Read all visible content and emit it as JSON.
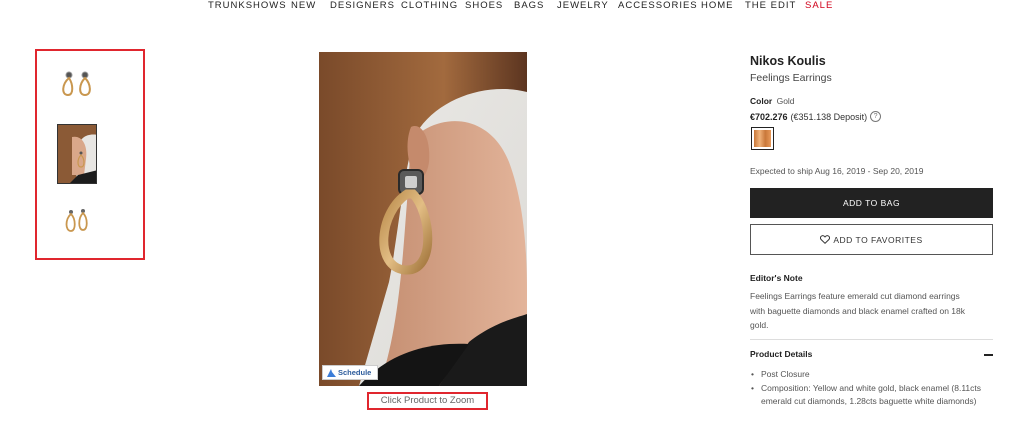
{
  "nav": {
    "items": [
      "TRUNKSHOWS",
      "NEW",
      "DESIGNERS",
      "CLOTHING",
      "SHOES",
      "BAGS",
      "JEWELRY",
      "ACCESSORIES",
      "HOME",
      "THE EDIT",
      "SALE"
    ]
  },
  "gallery": {
    "schedule_label": "Schedule",
    "zoom_text": "Click Product to Zoom"
  },
  "product": {
    "designer": "Nikos Koulis",
    "name": "Feelings Earrings",
    "color_label": "Color",
    "color_value": "Gold",
    "price": "€702.276",
    "deposit": "(€351.138 Deposit)",
    "help_icon": "?",
    "shipping": "Expected to ship Aug 16, 2019 - Sep 20, 2019",
    "add_to_bag": "ADD TO BAG",
    "add_to_favorites": "ADD TO FAVORITES",
    "editors_note_title": "Editor's Note",
    "editors_note": "Feelings Earrings feature emerald cut diamond earrings with baguette diamonds and black enamel crafted on 18k gold.",
    "details_title": "Product Details",
    "details": [
      "Post Closure",
      "Composition: Yellow and white gold, black enamel (8.11cts emerald cut diamonds, 1.28cts baguette white diamonds)"
    ]
  },
  "colors": {
    "accent_red": "#e0262e",
    "sale_red": "#d0021b",
    "button_dark": "#222222",
    "gold": "#c9974f"
  },
  "icons": {
    "heart": "heart-icon",
    "schedule": "schedule-icon",
    "help": "help-circle-icon",
    "collapse": "minus-icon"
  }
}
